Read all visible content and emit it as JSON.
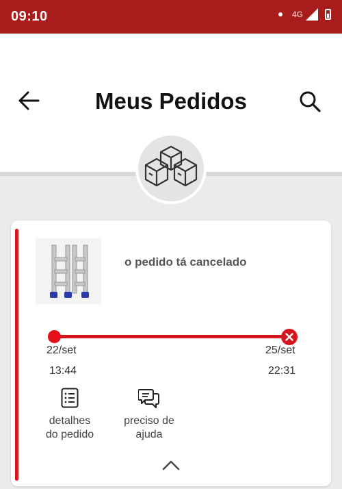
{
  "status_bar": {
    "time": "09:10",
    "network": "4G"
  },
  "header": {
    "title": "Meus Pedidos"
  },
  "order": {
    "status_text": "o pedido tá cancelado",
    "timeline": {
      "start_date": "22/set",
      "start_time": "13:44",
      "end_date": "25/set",
      "end_time": "22:31"
    },
    "actions": [
      {
        "line1": "detalhes",
        "line2": "do pedido"
      },
      {
        "line1": "preciso de",
        "line2": "ajuda"
      }
    ]
  },
  "colors": {
    "status_bar": "#a81c1c",
    "accent": "#d6161f",
    "background": "#ebebeb"
  }
}
